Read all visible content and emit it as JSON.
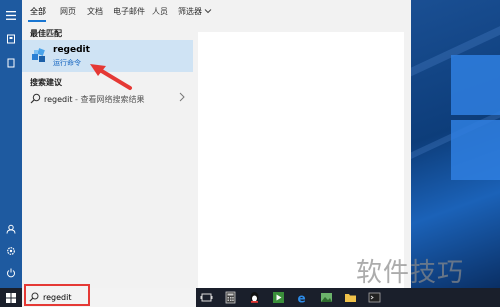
{
  "search_panel": {
    "tabs": [
      {
        "label": "全部",
        "active": true
      },
      {
        "label": "网页"
      },
      {
        "label": "文档"
      },
      {
        "label": "电子邮件"
      },
      {
        "label": "人员"
      },
      {
        "label": "筛选器"
      }
    ],
    "best_match_title": "最佳匹配",
    "best_match": {
      "name": "regedit",
      "subtitle": "运行命令",
      "icon": "registry-editor-icon"
    },
    "suggestions_title": "搜索建议",
    "suggestion": {
      "query": "regedit",
      "hint": " - 查看网络搜索结果",
      "icon": "search-icon"
    }
  },
  "taskbar": {
    "search_value": "regedit",
    "pinned_icons": [
      "task-view-icon",
      "calculator-icon",
      "qq-penguin-icon",
      "media-player-icon",
      "edge-icon",
      "photos-icon",
      "file-explorer-icon",
      "terminal-icon"
    ]
  },
  "watermark": "软件技巧",
  "colors": {
    "accent": "#1976d2",
    "highlight": "#cfe3f4",
    "sidebar": "#1e5aa0",
    "taskbar": "#1a1f2b",
    "annotation": "#e53935"
  }
}
